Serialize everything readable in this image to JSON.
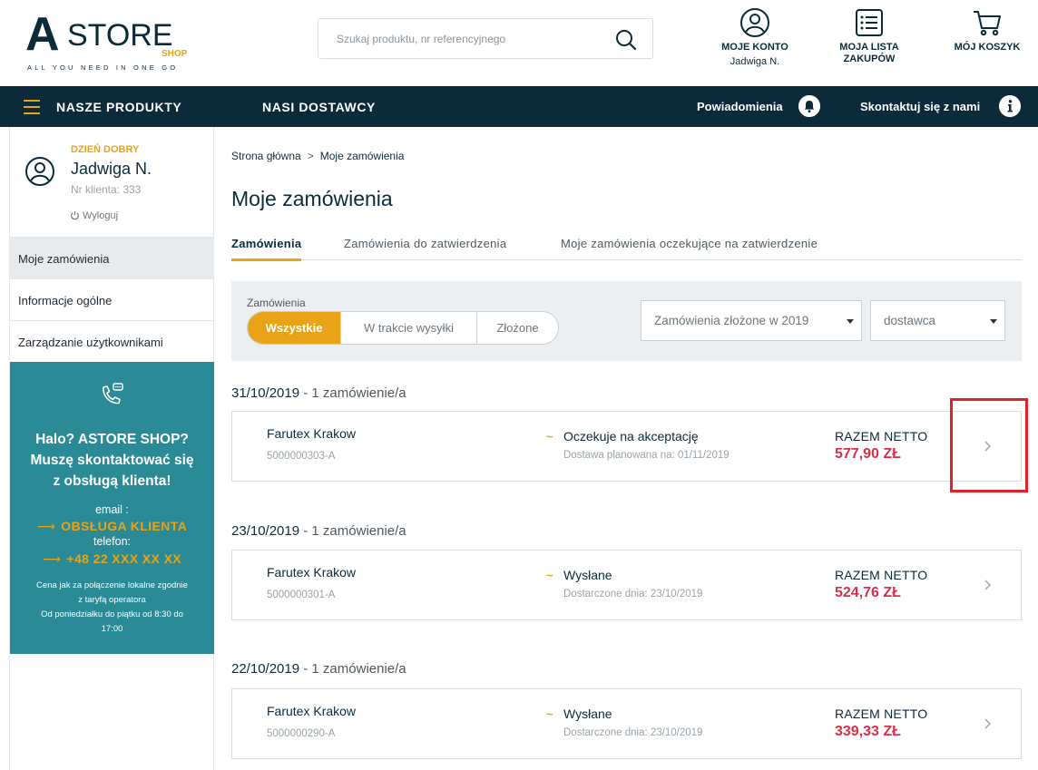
{
  "header": {
    "logo": {
      "a": "A",
      "store": "STORE",
      "shop": "SHOP",
      "tagline": "ALL YOU NEED IN ONE GO"
    },
    "search": {
      "placeholder": "Szukaj produktu, nr referencyjnego",
      "value": ""
    },
    "account": {
      "label": "MOJE KONTO",
      "user": "Jadwiga N."
    },
    "shopping_list": {
      "label_line1": "MOJA LISTA",
      "label_line2": "ZAKUPÓW"
    },
    "cart": {
      "label": "MÓJ KOSZYK"
    }
  },
  "nav": {
    "products": "NASZE PRODUKTY",
    "suppliers": "NASI DOSTAWCY",
    "notifications": "Powiadomienia",
    "contact": "Skontaktuj się z nami"
  },
  "sidebar": {
    "greeting": "DZIEŃ DOBRY",
    "name": "Jadwiga N.",
    "client_no": "Nr klienta: 333",
    "logout": "Wyloguj",
    "items": [
      {
        "label": "Moje zamówienia",
        "active": true
      },
      {
        "label": "Informacje ogólne",
        "active": false
      },
      {
        "label": "Zarządzanie użytkownikami",
        "active": false
      }
    ],
    "contact": {
      "title_line1": "Halo? ASTORE SHOP?",
      "title_line2": "Muszę skontaktować się",
      "title_line3": "z obsługą klienta!",
      "email_label": "email :",
      "email_value": "OBSŁUGA KLIENTA",
      "phone_label": "telefon:",
      "phone_value": "+48 22 XXX XX XX",
      "note_line1": "Cena jak za połączenie lokalne zgodnie",
      "note_line2": "z taryfą operatora",
      "note_line3": "Od poniedziałku do piątku od 8:30 do",
      "note_line4": "17:00"
    }
  },
  "main": {
    "breadcrumb": {
      "home": "Strona główna",
      "sep": ">",
      "current": "Moje zamówienia"
    },
    "title": "Moje zamówienia",
    "tabs": [
      {
        "label": "Zamówienia",
        "active": true
      },
      {
        "label": "Zamówienia do zatwierdzenia",
        "active": false
      },
      {
        "label": "Moje zamówienia oczekujące na zatwierdzenie",
        "active": false
      }
    ],
    "filters": {
      "label": "Zamówienia",
      "segments": [
        "Wszystkie",
        "W trakcie wysyłki",
        "Złożone"
      ],
      "selected_segment": "Wszystkie",
      "year_select": "Zamówienia złożone w 2019",
      "supplier_select": "dostawca"
    },
    "groups": [
      {
        "date": "31/10/2019",
        "count": "1 zamówienie/a",
        "order": {
          "supplier": "Farutex Krakow",
          "ref": "5000000303-A",
          "status": "Oczekuje na akceptację",
          "status_date": "Dostawa planowana na: 01/11/2019",
          "total_label": "RAZEM NETTO",
          "total_value": "577,90 ZŁ"
        }
      },
      {
        "date": "23/10/2019",
        "count": "1 zamówienie/a",
        "order": {
          "supplier": "Farutex Krakow",
          "ref": "5000000301-A",
          "status": "Wysłane",
          "status_date": "Dostarczone dnia: 23/10/2019",
          "total_label": "RAZEM NETTO",
          "total_value": "524,76 ZŁ"
        }
      },
      {
        "date": "22/10/2019",
        "count": "1 zamówienie/a",
        "order": {
          "supplier": "Farutex Krakow",
          "ref": "5000000290-A",
          "status": "Wysłane",
          "status_date": "Dostarczone dnia: 23/10/2019",
          "total_label": "RAZEM NETTO",
          "total_value": "339,33 ZŁ"
        }
      }
    ],
    "date_separator": " - ",
    "status_marker": "~"
  },
  "icons": {
    "search": "search-icon",
    "account": "user-circle-icon",
    "list": "list-icon",
    "cart": "cart-icon",
    "bell": "bell-icon",
    "info": "info-icon",
    "phone": "phone-chat-icon",
    "chevron": "chevron-right-icon",
    "logout": "power-icon",
    "arrow": "arrow-right-icon"
  },
  "colors": {
    "navy": "#0b2a3a",
    "accent": "#e8a317",
    "teal": "#2a8a96",
    "price": "#d9304a",
    "highlight": "#e0202a"
  }
}
